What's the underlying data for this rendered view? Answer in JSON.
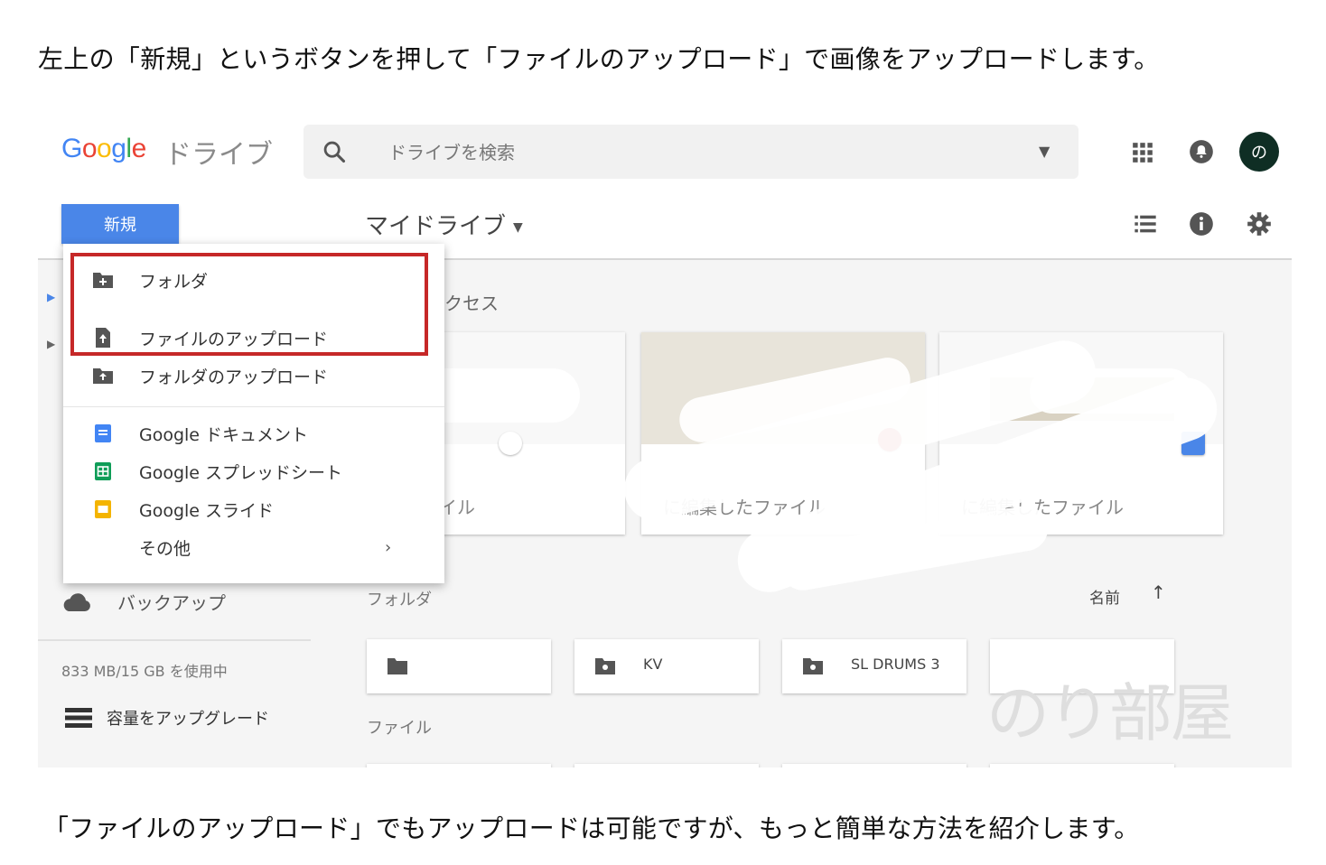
{
  "captions": {
    "top": "左上の「新規」というボタンを押して「ファイルのアップロード」で画像をアップロードします。",
    "bottom": "「ファイルのアップロード」でもアップロードは可能ですが、もっと簡単な方法を紹介します。"
  },
  "header": {
    "logo_letters": [
      "G",
      "o",
      "o",
      "g",
      "l",
      "e"
    ],
    "product": "ドライブ",
    "search_placeholder": "ドライブを検索",
    "avatar_initial": "の"
  },
  "toolbar": {
    "new_label": "新規",
    "location": "マイドライブ"
  },
  "sidebar": {
    "backup_label": "バックアップ",
    "storage_text": "833 MB/15 GB を使用中",
    "upgrade_label": "容量をアップグレード"
  },
  "new_menu": {
    "items": [
      {
        "label": "フォルダ"
      },
      {
        "label": "ファイルのアップロード"
      },
      {
        "label": "フォルダのアップロード"
      },
      {
        "label": "Google ドキュメント"
      },
      {
        "label": "Google スプレッドシート"
      },
      {
        "label": "Google スライド"
      },
      {
        "label": "その他"
      }
    ]
  },
  "main": {
    "quick_access_label": "クセス",
    "cards": [
      {
        "subtitle": "たファイル"
      },
      {
        "subtitle": "に編集したファイル"
      },
      {
        "subtitle": "に編集したファイル"
      }
    ],
    "folders_label": "フォルダ",
    "sort_label": "名前",
    "folders": [
      {
        "name": ""
      },
      {
        "name": "",
        "name_visible": "KV"
      },
      {
        "name": "SL DRUMS 3"
      },
      {
        "name": ""
      }
    ],
    "files_label": "ファイル"
  },
  "watermark": "のり部屋",
  "colors": {
    "accent": "#4a86e8",
    "highlight": "#c62828",
    "docs": "#4285f4",
    "sheets": "#0f9d58",
    "slides": "#f4b400"
  }
}
